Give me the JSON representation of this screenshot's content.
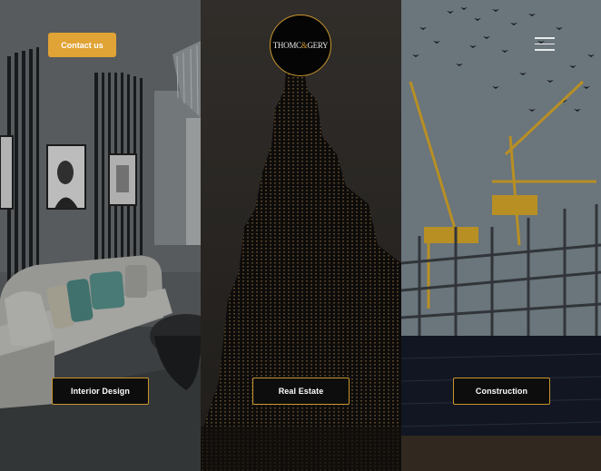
{
  "header": {
    "contact_label": "Contact us",
    "logo_first": "THOMC",
    "logo_amp": "&",
    "logo_second": "GERY",
    "menu_icon": "hamburger-menu-icon"
  },
  "panels": [
    {
      "label": "Interior Design",
      "image": "living-room-photo"
    },
    {
      "label": "Real Estate",
      "image": "skyscraper-photo"
    },
    {
      "label": "Construction",
      "image": "construction-cranes-photo"
    }
  ],
  "colors": {
    "accent": "#e0a335",
    "button_border": "#c9952d",
    "button_bg": "#0d0d0d"
  }
}
